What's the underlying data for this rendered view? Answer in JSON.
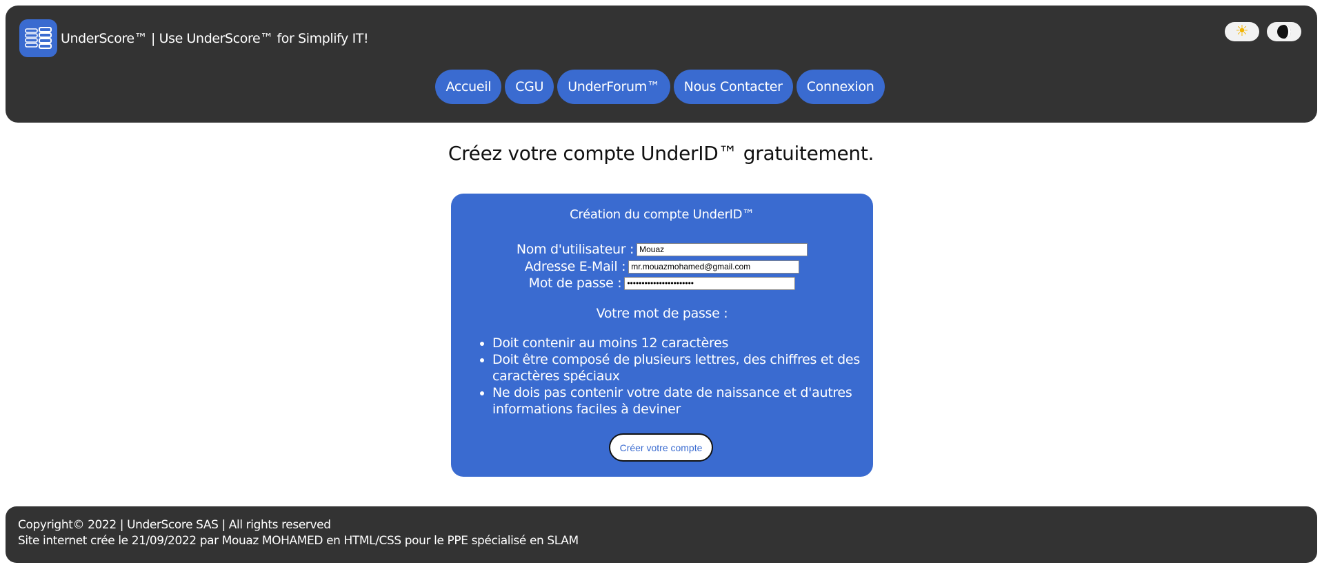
{
  "header": {
    "site_title": "UnderScore™ | Use UnderScore™ for Simplify IT!",
    "logo_icon": "menu-lines-icon",
    "theme_light_icon": "sun-icon",
    "theme_dark_icon": "half-moon-icon"
  },
  "nav": {
    "items": [
      {
        "label": "Accueil"
      },
      {
        "label": "CGU"
      },
      {
        "label": "UnderForum™"
      },
      {
        "label": "Nous Contacter"
      },
      {
        "label": "Connexion"
      }
    ]
  },
  "main": {
    "heading": "Créez votre compte UnderID™ gratuitement."
  },
  "form": {
    "title": "Création du compte UnderID™",
    "username_label": "Nom d'utilisateur :",
    "username_value": "Mouaz",
    "email_label": "Adresse E-Mail :",
    "email_value": "mr.mouazmohamed@gmail.com",
    "password_label": "Mot de passe :",
    "password_value": "•••••••••••••••••••••••",
    "password_heading": "Votre mot de passe :",
    "rules": [
      "Doit contenir au moins 12 caractères",
      "Doit être composé de plusieurs lettres, des chiffres et des caractères spéciaux",
      "Ne dois pas contenir votre date de naissance et d'autres informations faciles à deviner"
    ],
    "submit_label": "Créer votre compte"
  },
  "footer": {
    "line1": "Copyright© 2022 | UnderScore SAS | All rights reserved",
    "line2": "Site internet crée le 21/09/2022 par Mouaz MOHAMED en HTML/CSS pour le PPE spécialisé en SLAM"
  },
  "colors": {
    "accent": "#3a6bd0",
    "header_bg": "#333333",
    "page_bg": "#ffffff"
  }
}
